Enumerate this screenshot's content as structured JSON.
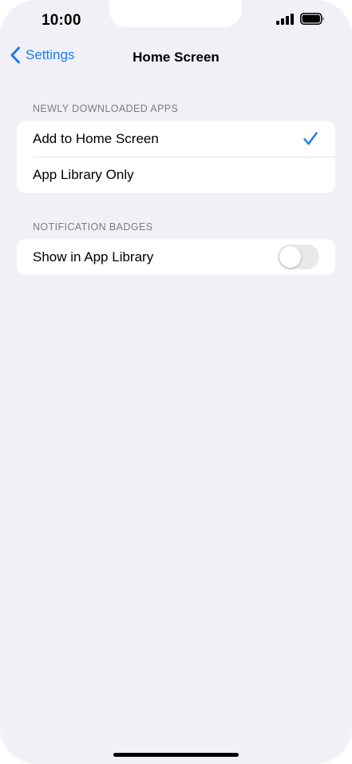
{
  "status_bar": {
    "time": "10:00",
    "icons": [
      "signal-icon",
      "battery-icon"
    ]
  },
  "nav": {
    "back_label": "Settings",
    "title": "Home Screen",
    "back_icon": "chevron-left-icon"
  },
  "sections": [
    {
      "header": "NEWLY DOWNLOADED APPS",
      "rows": [
        {
          "label": "Add to Home Screen",
          "selected": true
        },
        {
          "label": "App Library Only",
          "selected": false
        }
      ]
    },
    {
      "header": "NOTIFICATION BADGES",
      "rows": [
        {
          "label": "Show in App Library",
          "toggle": false
        }
      ]
    }
  ],
  "colors": {
    "accent": "#1a7cf3",
    "background": "#f1f0f6",
    "card": "#ffffff",
    "section_header": "#7c7c82",
    "toggle_off": "#e9e9ea"
  }
}
